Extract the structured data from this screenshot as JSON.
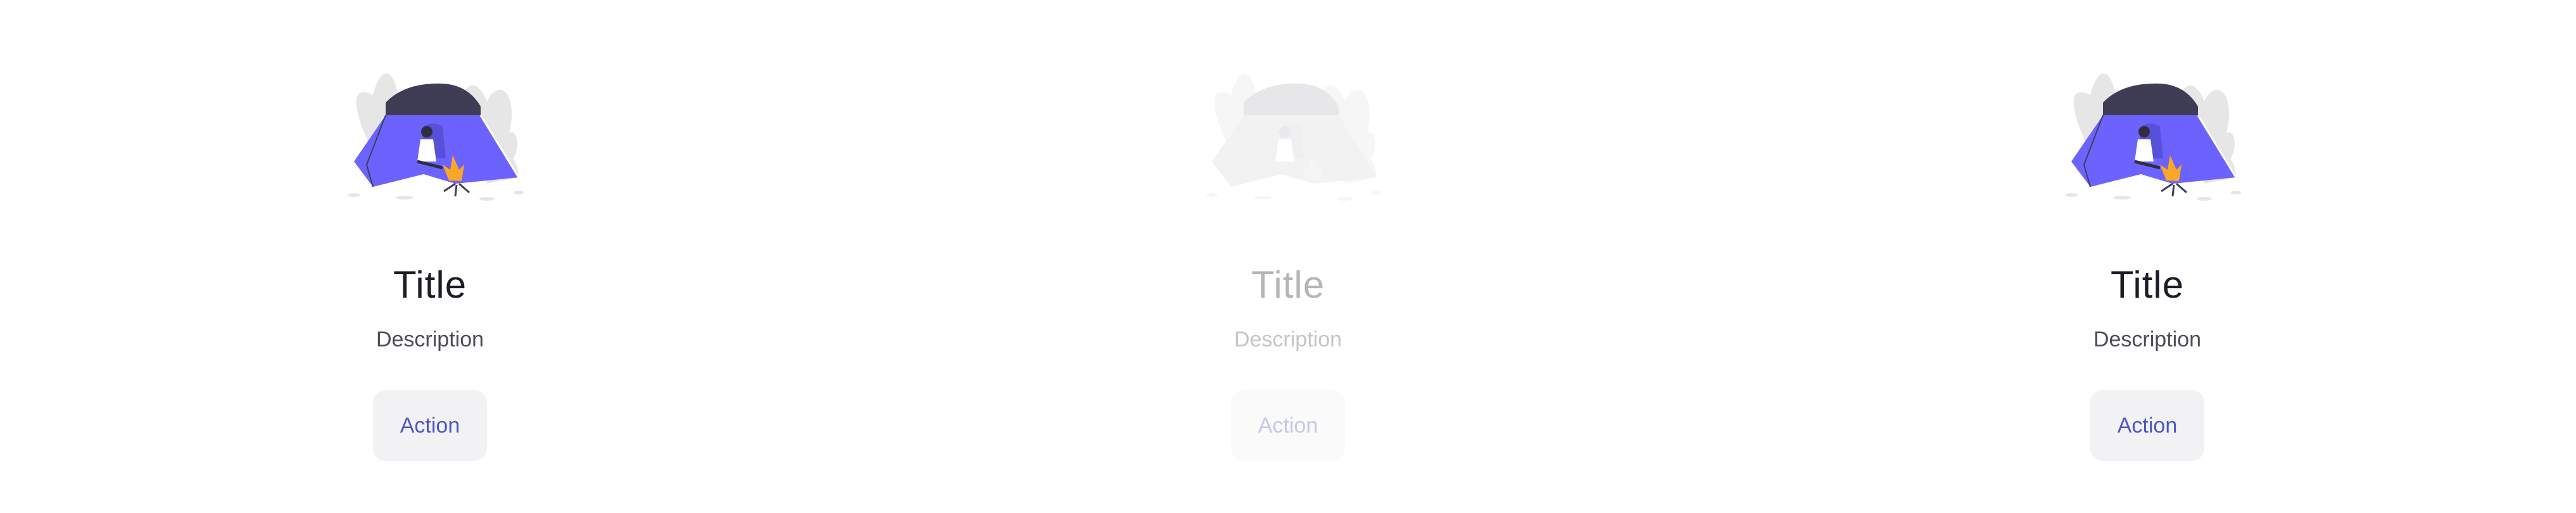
{
  "states": [
    {
      "id": "default",
      "enabled": true,
      "illustration": "camping-tent-icon",
      "title": "Title",
      "description": "Description",
      "action_label": "Action"
    },
    {
      "id": "disabled",
      "enabled": false,
      "illustration": "camping-tent-icon",
      "title": "Title",
      "description": "Description",
      "action_label": "Action"
    },
    {
      "id": "hover",
      "enabled": true,
      "illustration": "camping-tent-icon",
      "title": "Title",
      "description": "Description",
      "action_label": "Action"
    }
  ],
  "colors": {
    "title": "#1d1b26",
    "description": "#4e4c57",
    "action_text": "#4b55c2",
    "action_background": "#f2f2f4",
    "tent": "#6c63ff",
    "tent_top": "#3f3d56",
    "fire": "#f9a826"
  }
}
